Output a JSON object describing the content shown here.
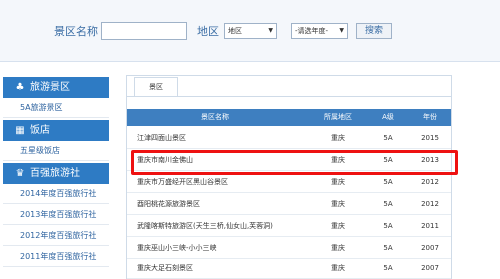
{
  "search": {
    "name_label": "景区名称",
    "name_value": "",
    "area_label": "地区",
    "region_select": "地区",
    "year_select": "-请选年度-",
    "button": "搜索"
  },
  "sidebar": {
    "sections": [
      {
        "icon": "tree-icon",
        "title": "旅游景区",
        "items": [
          "5A旅游景区"
        ]
      },
      {
        "icon": "hotel-icon",
        "title": "饭店",
        "items": [
          "五星级饭店"
        ]
      },
      {
        "icon": "trophy-icon",
        "title": "百强旅游社",
        "items": [
          "2014年度百强旅行社",
          "2013年度百强旅行社",
          "2012年度百强旅行社",
          "2011年度百强旅行社"
        ]
      }
    ]
  },
  "tab": {
    "label": "景区"
  },
  "table": {
    "columns": [
      "景区名称",
      "所属地区",
      "A级",
      "年份"
    ],
    "rows": [
      [
        "江津四面山景区",
        "重庆",
        "5A",
        "2015"
      ],
      [
        "重庆市南川金佛山",
        "重庆",
        "5A",
        "2013"
      ],
      [
        "重庆市万盛经开区黑山谷景区",
        "重庆",
        "5A",
        "2012"
      ],
      [
        "酉阳桃花源旅游景区",
        "重庆",
        "5A",
        "2012"
      ],
      [
        "武隆喀斯特旅游区(天生三桥,仙女山,芙蓉洞)",
        "重庆",
        "5A",
        "2011"
      ],
      [
        "重庆巫山小三峡-小小三峡",
        "重庆",
        "5A",
        "2007"
      ],
      [
        "重庆大足石刻景区",
        "重庆",
        "5A",
        "2007"
      ]
    ],
    "highlighted_row": 1,
    "highlight_color": "#ee1111",
    "header_color": "#3e7fc0"
  }
}
